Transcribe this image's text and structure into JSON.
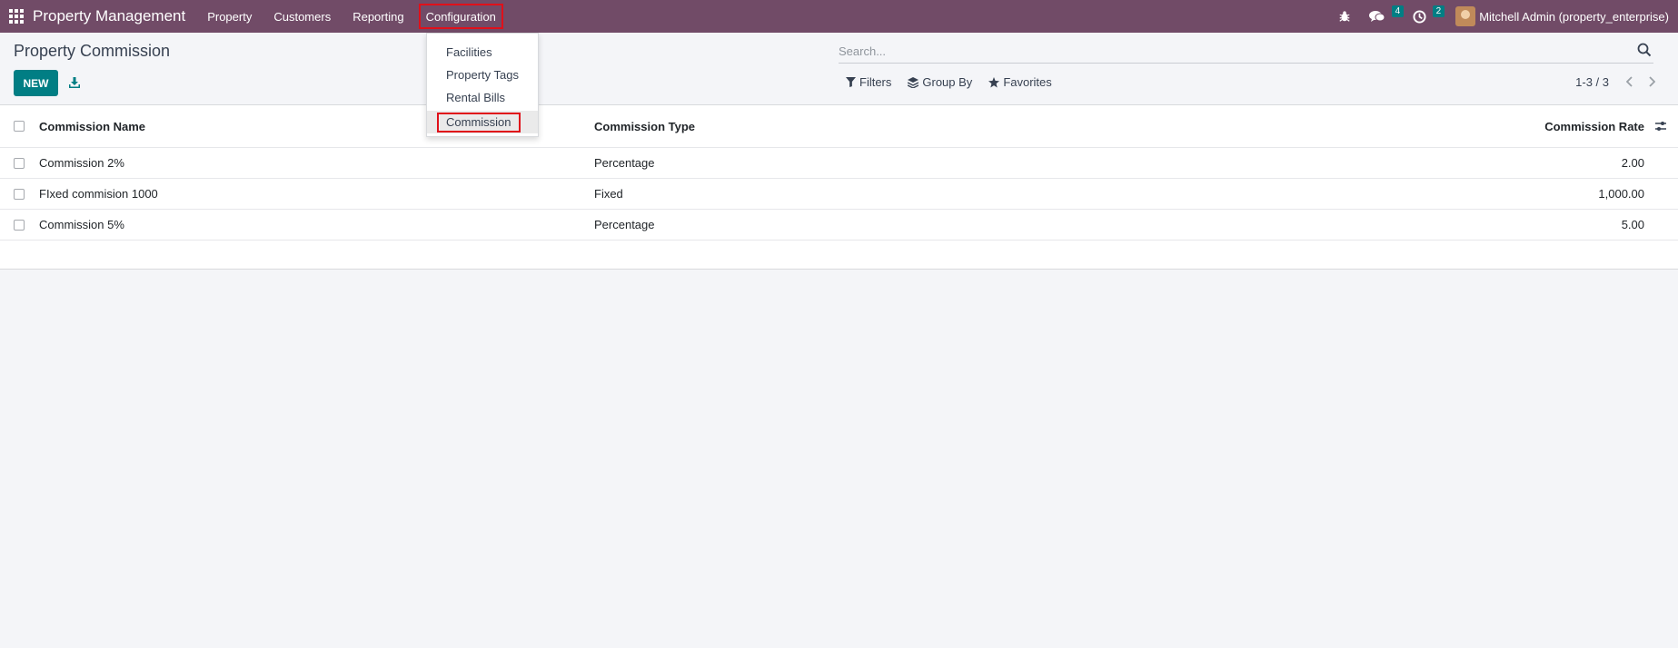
{
  "navbar": {
    "brand": "Property Management",
    "menus": [
      "Property",
      "Customers",
      "Reporting",
      "Configuration"
    ],
    "active_menu": "Configuration",
    "messages_count": "4",
    "activities_count": "2",
    "user_name": "Mitchell Admin (property_enterprise)",
    "bg_color": "#714b67"
  },
  "control_panel": {
    "title": "Property Commission",
    "new_label": "NEW",
    "search_placeholder": "Search...",
    "filters_label": "Filters",
    "group_by_label": "Group By",
    "favorites_label": "Favorites",
    "pager": "1-3 / 3"
  },
  "dropdown": {
    "items": [
      "Facilities",
      "Property Tags",
      "Rental Bills",
      "Commission"
    ],
    "selected": "Commission"
  },
  "list": {
    "columns": [
      "Commission Name",
      "Commission Type",
      "Commission Rate"
    ],
    "rows": [
      {
        "name": "Commission 2%",
        "type": "Percentage",
        "rate": "2.00"
      },
      {
        "name": "FIxed commision 1000",
        "type": "Fixed",
        "rate": "1,000.00"
      },
      {
        "name": "Commission 5%",
        "type": "Percentage",
        "rate": "5.00"
      }
    ]
  },
  "colors": {
    "accent": "#017e84",
    "highlight": "#e0101a"
  }
}
